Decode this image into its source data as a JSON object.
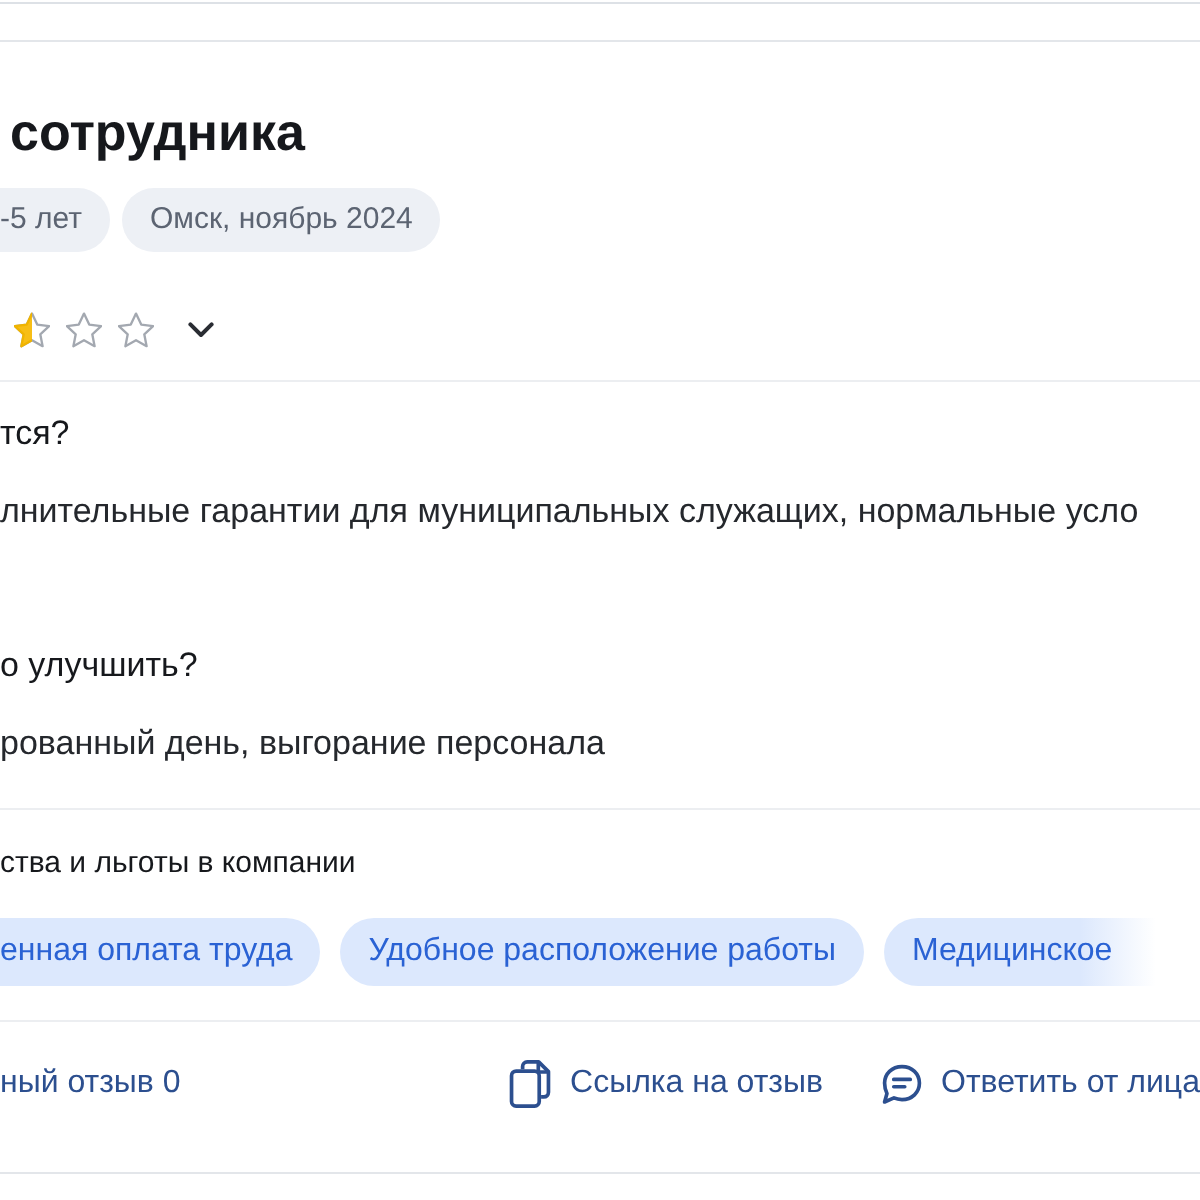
{
  "review": {
    "title": "сотрудника",
    "tags": [
      {
        "label": "-5 лет"
      },
      {
        "label": "Омск, ноябрь 2024"
      }
    ]
  },
  "rating": {
    "stars": 0.5
  },
  "sections": [
    {
      "heading": "тся?",
      "text": "лнительные гарантии для муниципальных служащих, нормальные усло"
    },
    {
      "heading": "о улучшить?",
      "text": "рованный день, выгорание персонала"
    }
  ],
  "benefits": {
    "heading": "ства и льготы в компании",
    "tags": [
      "енная оплата труда",
      "Удобное расположение работы",
      "Медицинское"
    ]
  },
  "actions": [
    {
      "kind": "helpful",
      "label": "ный отзыв 0"
    },
    {
      "kind": "link",
      "label": "Ссылка на отзыв"
    },
    {
      "kind": "reply",
      "label": "Ответить от лица"
    }
  ]
}
